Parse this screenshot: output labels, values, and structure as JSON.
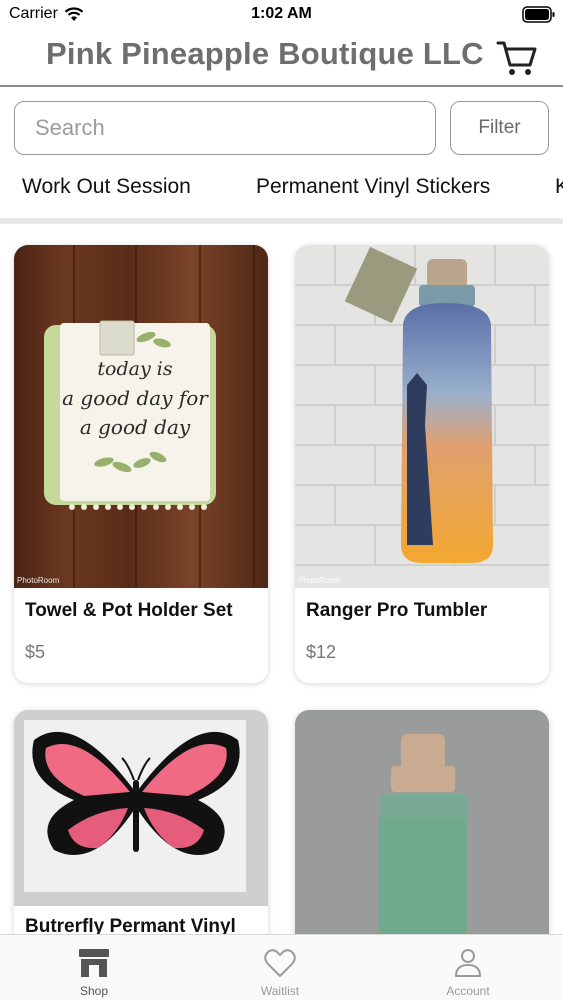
{
  "status_bar": {
    "carrier": "Carrier",
    "time": "1:02 AM"
  },
  "header": {
    "title": "Pink Pineapple Boutique LLC",
    "cart_icon": "shopping-cart-icon"
  },
  "search": {
    "placeholder": "Search",
    "value": ""
  },
  "filter": {
    "label": "Filter"
  },
  "categories": [
    {
      "label": "Work Out Session"
    },
    {
      "label": "Permanent Vinyl Stickers"
    },
    {
      "label": "K"
    }
  ],
  "products": [
    {
      "name": "Towel & Pot Holder Set",
      "price": "$5",
      "image_text": "today is a good day for a good day",
      "watermark": "PhotoRoom"
    },
    {
      "name": "Ranger Pro Tumbler",
      "price": "$12",
      "watermark": "PhotoRoom"
    },
    {
      "name": "Butrerfly Permant Vinyl",
      "price": ""
    },
    {
      "name": "",
      "price": ""
    }
  ],
  "tabs": [
    {
      "label": "Shop",
      "icon": "store-icon",
      "active": true
    },
    {
      "label": "Waitlist",
      "icon": "heart-icon",
      "active": false
    },
    {
      "label": "Account",
      "icon": "person-icon",
      "active": false
    }
  ]
}
